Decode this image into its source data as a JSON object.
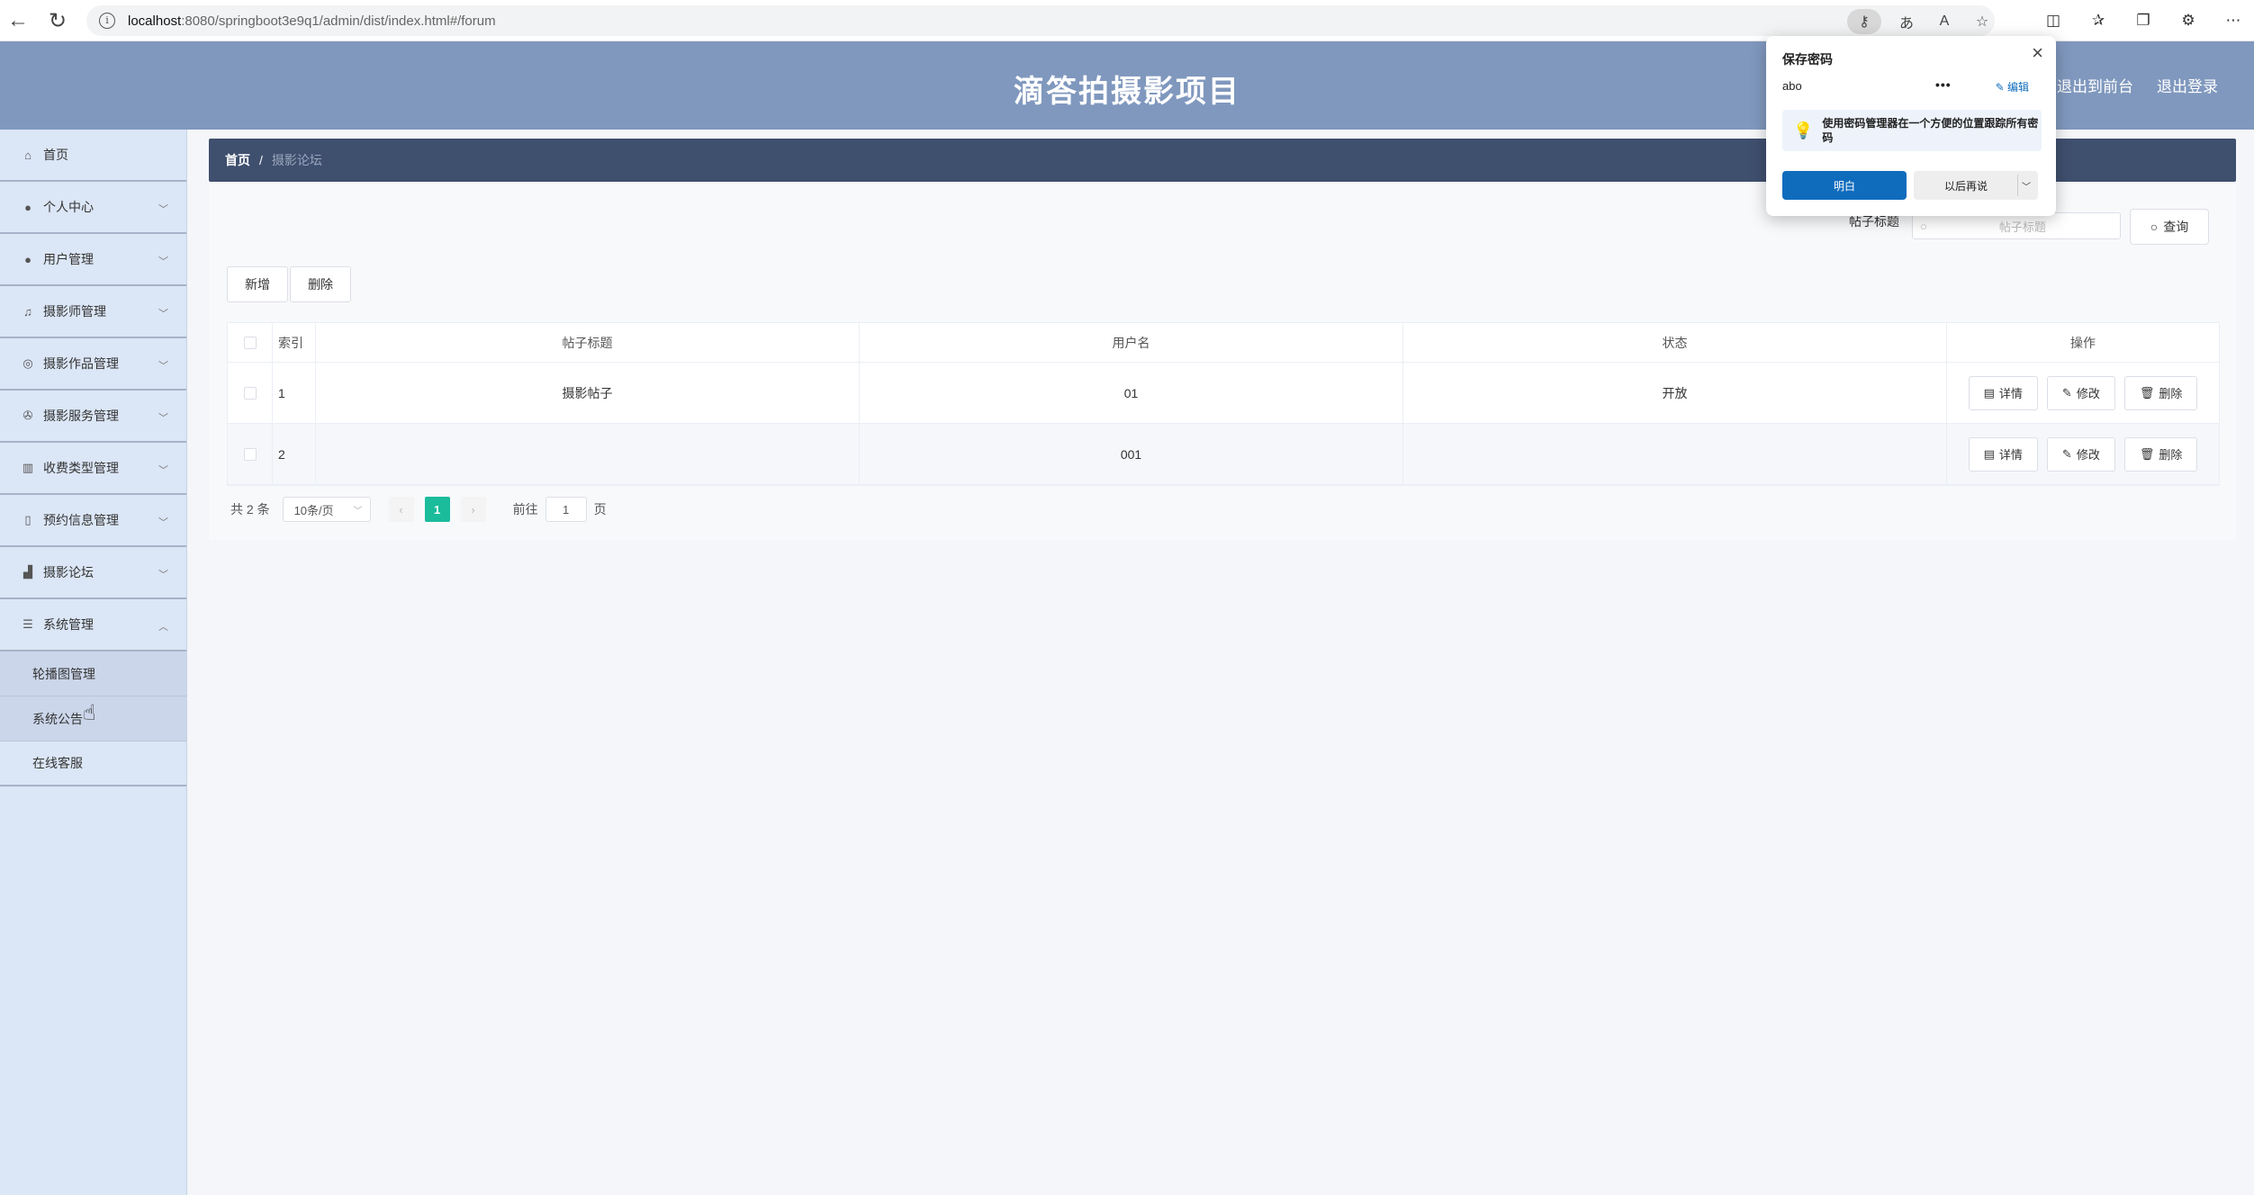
{
  "browser": {
    "url_host": "localhost",
    "url_rest": ":8080/springboot3e9q1/admin/dist/index.html#/forum"
  },
  "header": {
    "title": "滴答拍摄影项目",
    "link_front": "退出到前台",
    "link_logout": "退出登录"
  },
  "sidebar": {
    "items": [
      {
        "label": "首页",
        "icon": "home-icon"
      },
      {
        "label": "个人中心",
        "icon": "user-icon"
      },
      {
        "label": "用户管理",
        "icon": "user-icon"
      },
      {
        "label": "摄影师管理",
        "icon": "bell-icon"
      },
      {
        "label": "摄影作品管理",
        "icon": "circle-icon"
      },
      {
        "label": "摄影服务管理",
        "icon": "aperture-icon"
      },
      {
        "label": "收费类型管理",
        "icon": "chart-icon"
      },
      {
        "label": "预约信息管理",
        "icon": "phone-icon"
      },
      {
        "label": "摄影论坛",
        "icon": "forum-icon"
      },
      {
        "label": "系统管理",
        "icon": "settings-icon"
      }
    ],
    "sub_items": [
      "轮播图管理",
      "系统公告",
      "在线客服"
    ]
  },
  "breadcrumb": {
    "home": "首页",
    "sep": "/",
    "current": "摄影论坛"
  },
  "search": {
    "label": "帖子标题",
    "placeholder": "帖子标题",
    "button": "查询"
  },
  "actions": {
    "add": "新增",
    "delete": "删除"
  },
  "table": {
    "headers": [
      "索引",
      "帖子标题",
      "用户名",
      "状态",
      "操作"
    ],
    "rows": [
      {
        "index": "1",
        "title": "摄影帖子",
        "user": "01",
        "status": "开放"
      },
      {
        "index": "2",
        "title": "",
        "user": "001",
        "status": ""
      }
    ],
    "op_detail": "详情",
    "op_edit": "修改",
    "op_delete": "删除"
  },
  "pagination": {
    "total": "共 2 条",
    "page_size": "10条/页",
    "current_page": "1",
    "goto_label": "前往",
    "goto_value": "1",
    "page_suffix": "页"
  },
  "password_popup": {
    "title": "保存密码",
    "username": "abo",
    "masked": "•••",
    "edit": "编辑",
    "tip": "使用密码管理器在一个方便的位置跟踪所有密码",
    "ok": "明白",
    "later": "以后再说"
  },
  "colors": {
    "header_bg": "#8098be",
    "sidebar_bg": "#dbe6f6",
    "breadcrumb_bg": "#3f4f6e",
    "pager_active": "#1abc9c",
    "popup_primary": "#0f6cbd"
  }
}
